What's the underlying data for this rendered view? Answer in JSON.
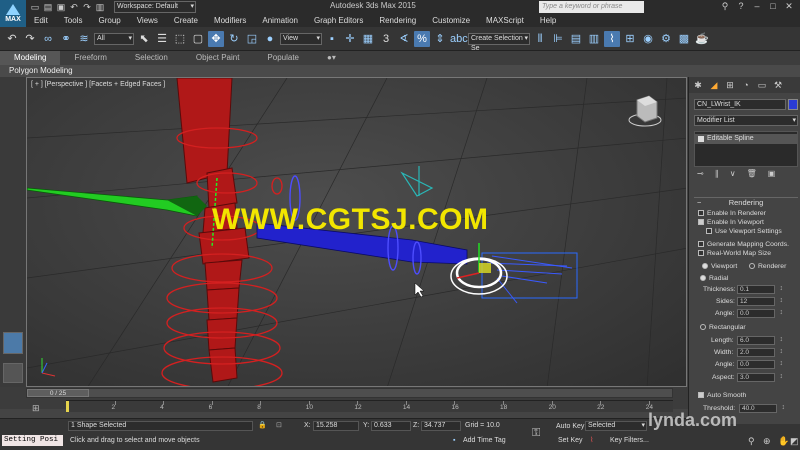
{
  "app": {
    "title": "Autodesk 3ds Max  2015",
    "logo": "MAX",
    "workspace": "Workspace: Default",
    "search_placeholder": "Type a keyword or phrase"
  },
  "menu": [
    "Edit",
    "Tools",
    "Group",
    "Views",
    "Create",
    "Modifiers",
    "Animation",
    "Graph Editors",
    "Rendering",
    "Customize",
    "MAXScript",
    "Help"
  ],
  "toolbar": {
    "filter_value": "All",
    "refcoord_value": "View",
    "named_selection": "Create Selection Se",
    "angle_snap_label": "3"
  },
  "ribbon": {
    "tabs": [
      "Modeling",
      "Freeform",
      "Selection",
      "Object Paint",
      "Populate"
    ],
    "active": "Modeling",
    "panel_label": "Polygon Modeling"
  },
  "viewport": {
    "label": "[ + ] [Perspective ] [Facets + Edged Faces ]",
    "overlay_text": "WWW.CGTSJ.COM"
  },
  "command_panel": {
    "object_name": "CN_LWrist_IK",
    "object_color": "#2a3bd4",
    "modifier_list": "Modifier List",
    "stack_item": "Editable Spline",
    "rollout_title": "Rendering",
    "enable_in_renderer": "Enable In Renderer",
    "enable_in_viewport": "Enable In Viewport",
    "use_viewport_settings": "Use Viewport Settings",
    "generate_mapping": "Generate Mapping Coords.",
    "real_world": "Real-World Map Size",
    "viewport_radio": "Viewport",
    "renderer_radio": "Renderer",
    "radial": "Radial",
    "thickness_label": "Thickness:",
    "thickness_value": "0.1",
    "sides_label": "Sides:",
    "sides_value": "12",
    "angle_label": "Angle:",
    "angle_value": "0.0",
    "rectangular": "Rectangular",
    "length_label": "Length:",
    "length_value": "6.0",
    "width_label": "Width:",
    "width_value": "2.0",
    "angle2_label": "Angle:",
    "angle2_value": "0.0",
    "aspect_label": "Aspect:",
    "aspect_value": "3.0",
    "auto_smooth": "Auto Smooth",
    "threshold_label": "Threshold:",
    "threshold_value": "40.0"
  },
  "timeline": {
    "frame_label": "0 / 25",
    "ticks": [
      "2",
      "4",
      "6",
      "8",
      "10",
      "12",
      "14",
      "16",
      "18",
      "20",
      "22",
      "24"
    ],
    "frame_current": 0,
    "frame_total": 25
  },
  "status": {
    "script_label": "Setting Posi",
    "selection": "1 Shape Selected",
    "prompt": "Click and drag to select and move objects",
    "x_label": "X:",
    "x_value": "15.258",
    "y_label": "Y:",
    "y_value": "0.633",
    "z_label": "Z:",
    "z_value": "34.737",
    "grid": "Grid = 10.0",
    "add_time_tag": "Add Time Tag",
    "auto_key": "Auto Key",
    "selected_value": "Selected",
    "set_key": "Set Key",
    "key_filters": "Key Filters...",
    "watermark": "lynda.com"
  }
}
